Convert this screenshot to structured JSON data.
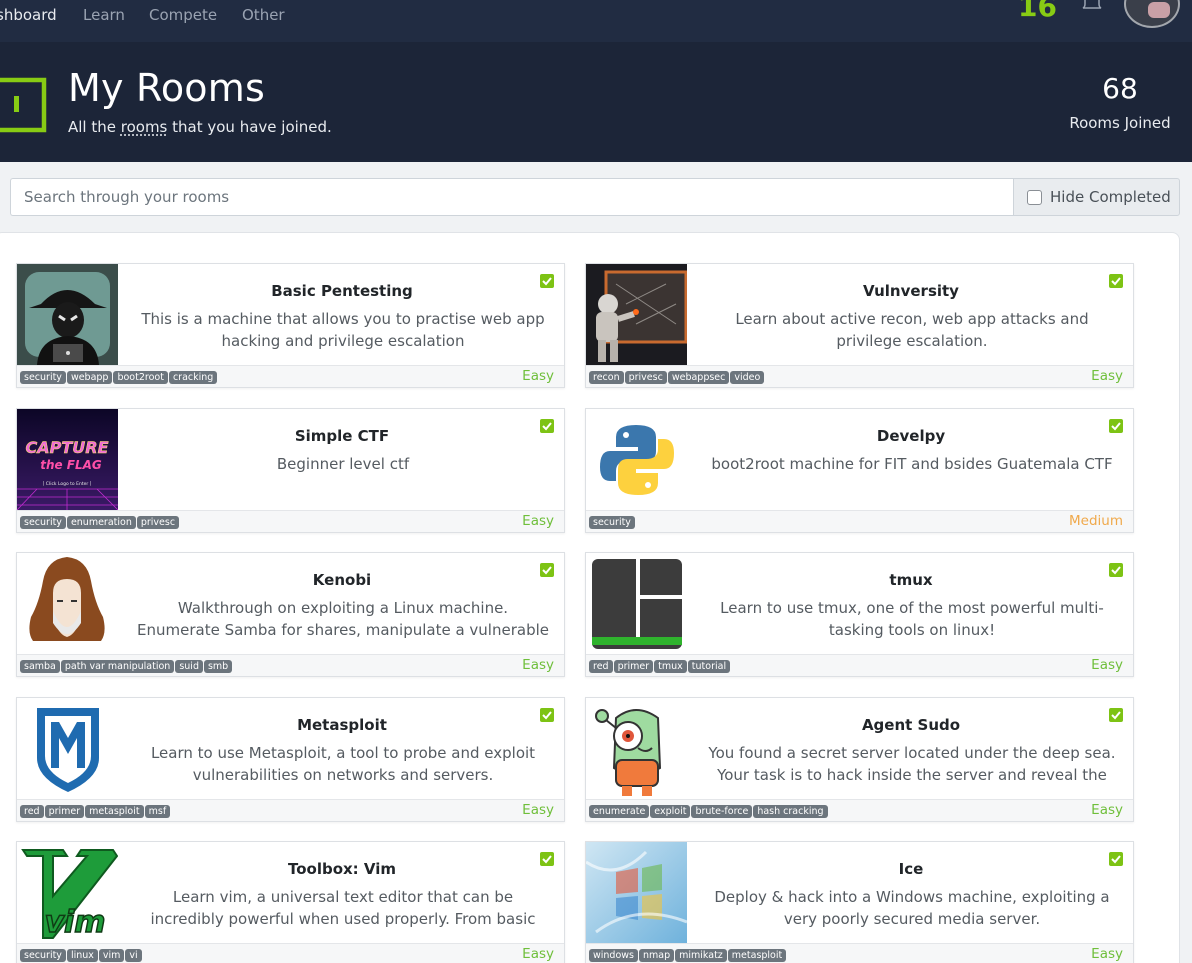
{
  "nav": {
    "items": [
      "shboard",
      "Learn",
      "Compete",
      "Other"
    ],
    "streak": "16"
  },
  "hero": {
    "title": "My Rooms",
    "subtitle_prefix": "All the ",
    "subtitle_link": "rooms",
    "subtitle_suffix": " that you have joined.",
    "count": "68",
    "count_label": "Rooms Joined",
    "accent_color": "#88cc14"
  },
  "search": {
    "placeholder": "Search through your rooms",
    "hide_completed_label": "Hide Completed"
  },
  "rooms": [
    {
      "title": "Basic Pentesting",
      "description": "This is a machine that allows you to practise web app hacking and privilege escalation",
      "tags": [
        "security",
        "webapp",
        "boot2root",
        "cracking"
      ],
      "difficulty": "Easy",
      "thumb_icon": "hacker-icon"
    },
    {
      "title": "Vulnversity",
      "description": "Learn about active recon, web app attacks and privilege escalation.",
      "tags": [
        "recon",
        "privesc",
        "webappsec",
        "video"
      ],
      "difficulty": "Easy",
      "thumb_icon": "astronaut-icon"
    },
    {
      "title": "Simple CTF",
      "description": "Beginner level ctf",
      "tags": [
        "security",
        "enumeration",
        "privesc"
      ],
      "difficulty": "Easy",
      "thumb_icon": "capture-the-flag-icon",
      "thumb_text_1": "CAPTURE",
      "thumb_text_2": "the FLAG",
      "thumb_text_3": "[ Click Logo to Enter ]"
    },
    {
      "title": "Develpy",
      "description": "boot2root machine for FIT and bsides Guatemala CTF",
      "tags": [
        "security"
      ],
      "difficulty": "Medium",
      "thumb_icon": "python-icon"
    },
    {
      "title": "Kenobi",
      "description": "Walkthrough on exploiting a Linux machine. Enumerate Samba for shares, manipulate a vulnerable version of…",
      "tags": [
        "samba",
        "path var manipulation",
        "suid",
        "smb"
      ],
      "difficulty": "Easy",
      "thumb_icon": "kenobi-icon"
    },
    {
      "title": "tmux",
      "description": "Learn to use tmux, one of the most powerful multi-tasking tools on linux!",
      "tags": [
        "red",
        "primer",
        "tmux",
        "tutorial"
      ],
      "difficulty": "Easy",
      "thumb_icon": "tmux-icon"
    },
    {
      "title": "Metasploit",
      "description": "Learn to use Metasploit, a tool to probe and exploit vulnerabilities on networks and servers.",
      "tags": [
        "red",
        "primer",
        "metasploit",
        "msf"
      ],
      "difficulty": "Easy",
      "thumb_icon": "metasploit-icon"
    },
    {
      "title": "Agent Sudo",
      "description": "You found a secret server located under the deep sea. Your task is to hack inside the server and reveal the truth.",
      "tags": [
        "enumerate",
        "exploit",
        "brute-force",
        "hash cracking"
      ],
      "difficulty": "Easy",
      "thumb_icon": "alien-robot-icon"
    },
    {
      "title": "Toolbox: Vim",
      "description": "Learn vim, a universal text editor that can be incredibly powerful when used properly. From basic text editing to…",
      "tags": [
        "security",
        "linux",
        "vim",
        "vi"
      ],
      "difficulty": "Easy",
      "thumb_icon": "vim-icon",
      "thumb_text_1": "vim"
    },
    {
      "title": "Ice",
      "description": "Deploy & hack into a Windows machine, exploiting a very poorly secured media server.",
      "tags": [
        "windows",
        "nmap",
        "mimikatz",
        "metasploit"
      ],
      "difficulty": "Easy",
      "thumb_icon": "windows-ice-icon"
    }
  ]
}
